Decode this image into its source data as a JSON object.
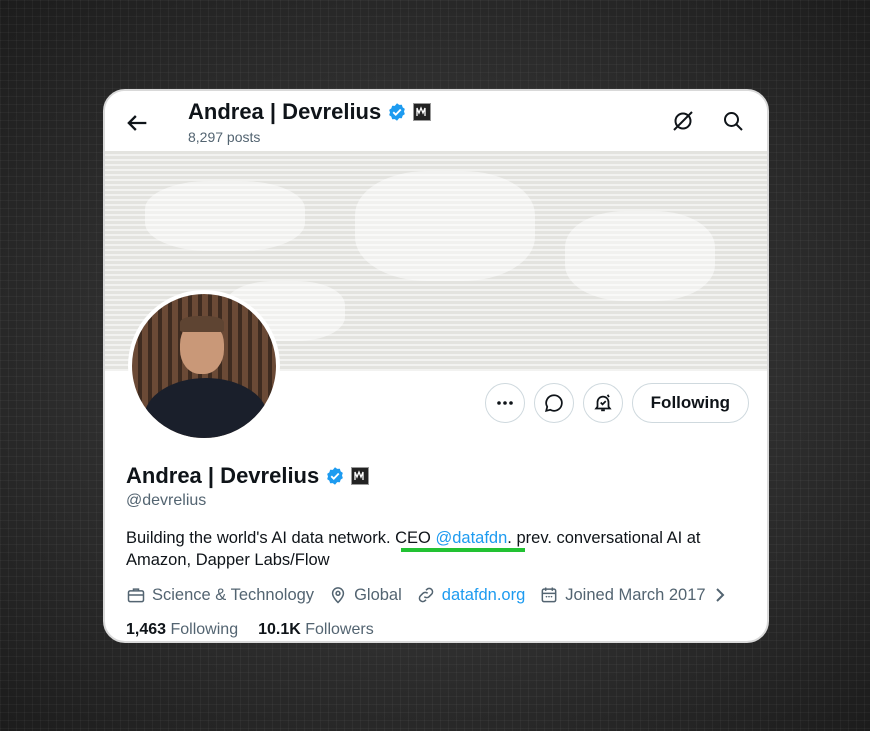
{
  "header": {
    "display_name": "Andrea | Devrelius",
    "post_count": "8,297 posts"
  },
  "profile": {
    "display_name": "Andrea | Devrelius",
    "handle": "@devrelius",
    "bio_part1": "Building the world's AI data network. CEO ",
    "bio_mention": "@datafdn",
    "bio_part2": ". prev. conversational AI at Amazon, Dapper Labs/Flow",
    "follow_label": "Following"
  },
  "meta": {
    "category": "Science & Technology",
    "location": "Global",
    "website": "datafdn.org",
    "joined": "Joined March 2017"
  },
  "stats": {
    "following_count": "1,463",
    "following_label": "Following",
    "followers_count": "10.1K",
    "followers_label": "Followers"
  },
  "colors": {
    "accent": "#1d9bf0",
    "highlight": "#22c233",
    "text": "#0f1419",
    "muted": "#536471"
  },
  "icons": [
    "back-arrow-icon",
    "verified-badge-icon",
    "affiliate-badge-icon",
    "refresh-icon",
    "search-icon",
    "more-icon",
    "message-icon",
    "notification-bell-icon",
    "briefcase-icon",
    "location-pin-icon",
    "link-icon",
    "calendar-icon",
    "chevron-right-icon"
  ]
}
